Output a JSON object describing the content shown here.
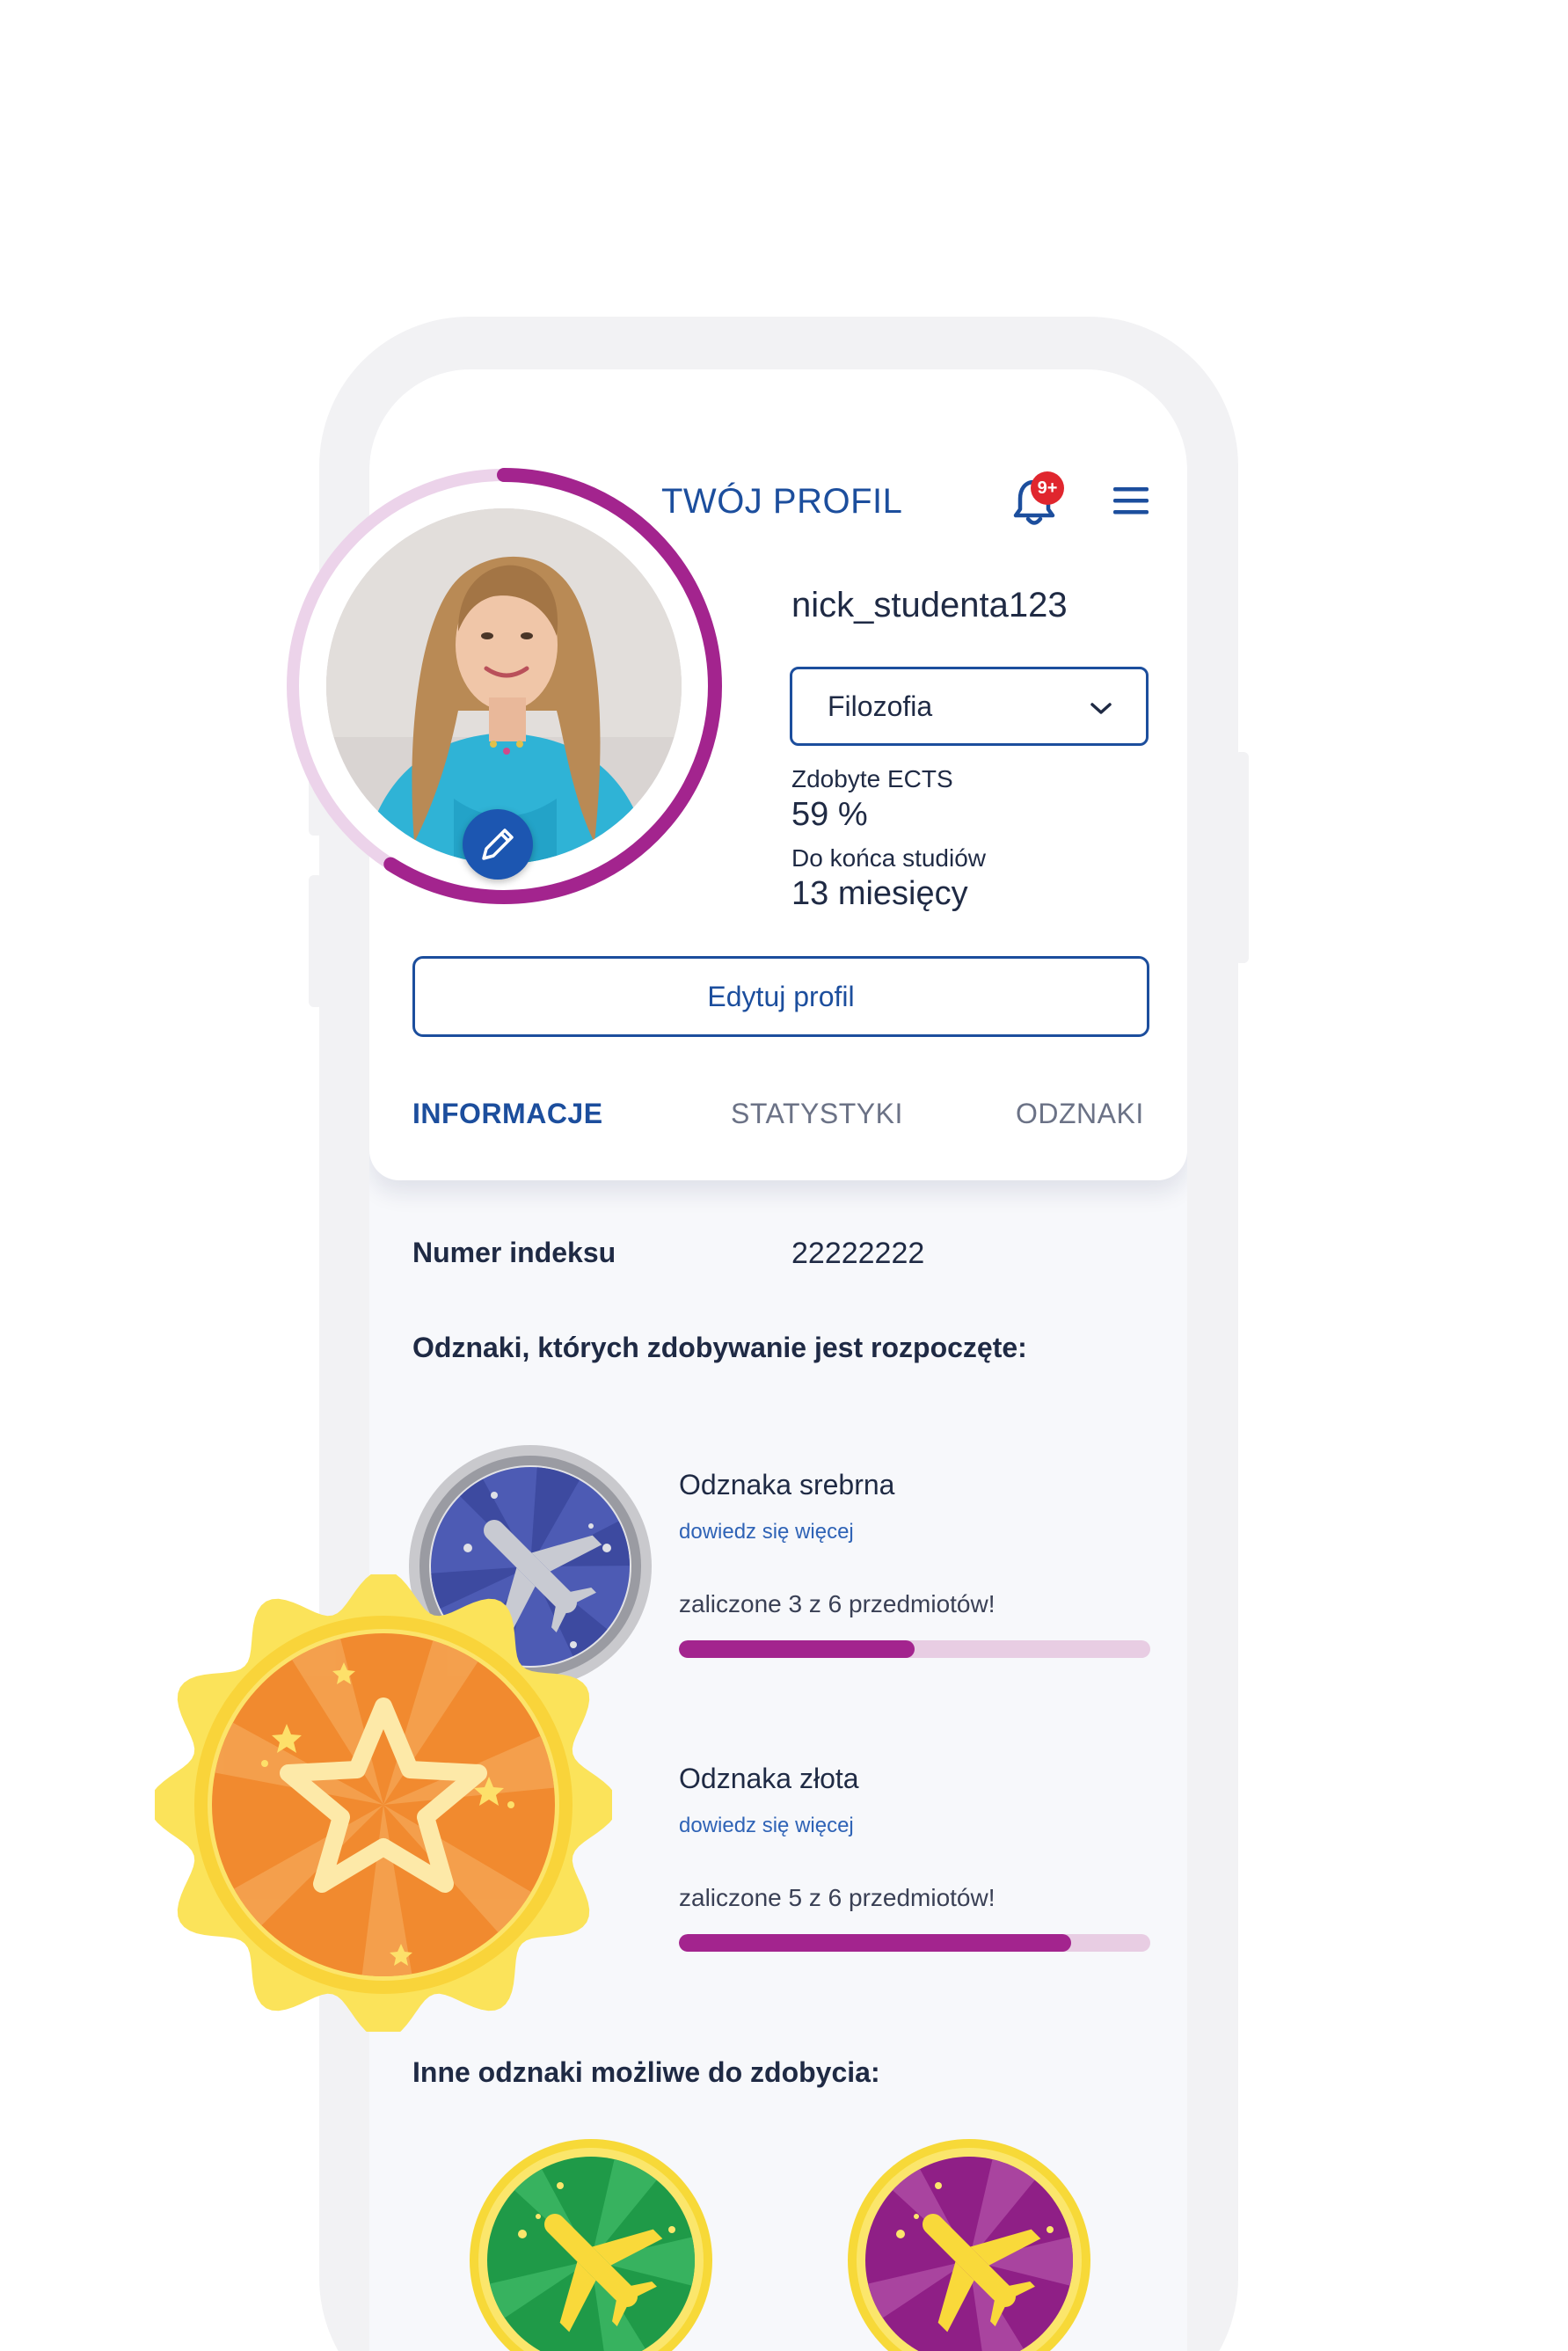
{
  "header": {
    "title": "TWÓJ PROFIL",
    "notification_badge": "9+",
    "notification_icon": "bell-icon",
    "menu_icon": "hamburger-menu-icon"
  },
  "profile": {
    "username": "nick_studenta123",
    "field_of_study": "Filozofia",
    "ects_label": "Zdobyte ECTS",
    "ects_value": "59 %",
    "ects_progress": 0.59,
    "remaining_label": "Do końca studiów",
    "remaining_value": "13 miesięcy",
    "edit_button": "Edytuj profil"
  },
  "tabs": [
    {
      "label": "INFORMACJE",
      "active": true
    },
    {
      "label": "STATYSTYKI",
      "active": false
    },
    {
      "label": "ODZNAKI",
      "active": false
    }
  ],
  "info": {
    "index_label": "Numer indeksu",
    "index_value": "22222222",
    "started_heading": "Odznaki, których zdobywanie jest rozpoczęte:",
    "other_heading": "Inne odznaki możliwe do zdobycia:"
  },
  "badges_started": [
    {
      "title": "Odznaka srebrna",
      "link": "dowiedz się więcej",
      "progress_text": "zaliczone 3 z 6 przedmiotów!",
      "progress": 0.5,
      "icon": "silver-plane-badge-icon"
    },
    {
      "title": "Odznaka złota",
      "link": "dowiedz się więcej",
      "progress_text": "zaliczone 5 z 6 przedmiotów!",
      "progress": 0.833,
      "icon": "gold-star-badge-icon"
    }
  ],
  "badges_other": [
    {
      "icon": "green-plane-badge-icon"
    },
    {
      "icon": "purple-plane-badge-icon"
    }
  ],
  "colors": {
    "primary_blue": "#1c4e9d",
    "accent_purple": "#a3248e",
    "track_pink": "#e8cde3",
    "notification_red": "#e0262e",
    "gold": "#fbd934",
    "orange": "#f18a2f"
  }
}
